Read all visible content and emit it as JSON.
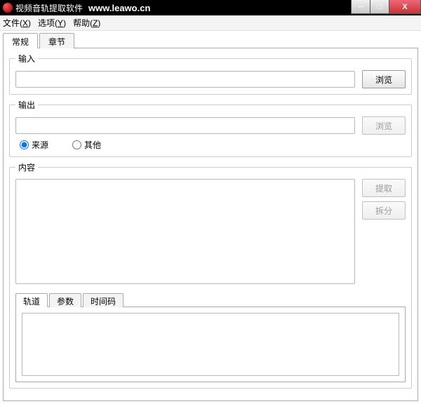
{
  "titlebar": {
    "app_title": "视频音轨提取软件",
    "url": "www.leawo.cn"
  },
  "menu": {
    "file": {
      "label": "文件",
      "mnemonic": "X"
    },
    "options": {
      "label": "选项",
      "mnemonic": "Y"
    },
    "help": {
      "label": "帮助",
      "mnemonic": "Z"
    }
  },
  "tabs": {
    "general": "常规",
    "chapters": "章节"
  },
  "input_group": {
    "legend": "输入",
    "value": "",
    "browse": "浏览"
  },
  "output_group": {
    "legend": "输出",
    "value": "",
    "browse": "浏览",
    "radio_source": "来源",
    "radio_other": "其他"
  },
  "content_group": {
    "legend": "内容",
    "extract": "提取",
    "split": "拆分"
  },
  "inner_tabs": {
    "tracks": "轨道",
    "params": "参数",
    "timecode": "时间码"
  },
  "win_controls": {
    "minimize": "─",
    "maximize": "□",
    "close": "X"
  }
}
